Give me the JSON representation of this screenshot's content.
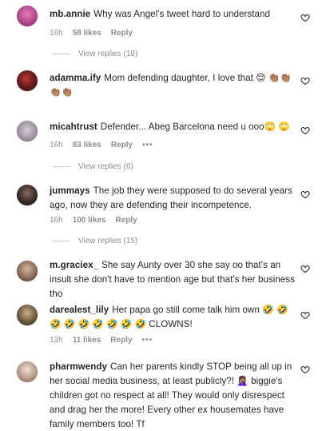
{
  "comments": [
    {
      "username": "mb.annie",
      "text": "Why was Angel's tweet hard to understand",
      "time": "16h",
      "likes": "58 likes",
      "reply": "Reply",
      "view_replies": "View replies (18)",
      "avatar_color": "#b3478a"
    },
    {
      "username": "adamma.ify",
      "text": "Mom defending daughter, I love that 😌 👏🏽👏🏽👏🏽👏🏽",
      "avatar_color": "#5a2c2c"
    },
    {
      "username": "micahtrust",
      "text": "Defender... Abeg Barcelona need u ooo🙄 🙄",
      "time": "16h",
      "likes": "83 likes",
      "reply": "Reply",
      "more": "•••",
      "view_replies": "View replies (6)",
      "avatar_color": "#a89aa8"
    },
    {
      "username": "jummays",
      "text": "The job they were supposed to do several years ago, now they are defending their incompetence.",
      "time": "16h",
      "likes": "100 likes",
      "reply": "Reply",
      "view_replies": "View replies (15)",
      "avatar_color": "#3a2a26"
    },
    {
      "username": "m.graciex_",
      "text": "She say Aunty over 30 she say oo that's an insult she don't have to mention age but that's her business tho",
      "avatar_color": "#8a6b58"
    },
    {
      "username": "darealest_lily",
      "text": "Her papa go still come talk him own 🤣 🤣 🤣 🤣 🤣 🤣 🤣 🤣 🤣 CLOWNS!",
      "time": "13h",
      "likes": "11 likes",
      "reply": "Reply",
      "more": "•••",
      "avatar_color": "#6b5a3e"
    },
    {
      "username": "pharmwendy",
      "text": "Can her parents kindly STOP being all up in her social media business, at least publicly?! 🤦🏽‍♀️ biggie's children got no respect at all! They would only disrespect and drag her the more! Every other ex housemates have family members too! Tf",
      "avatar_color": "#b89a8a"
    }
  ]
}
